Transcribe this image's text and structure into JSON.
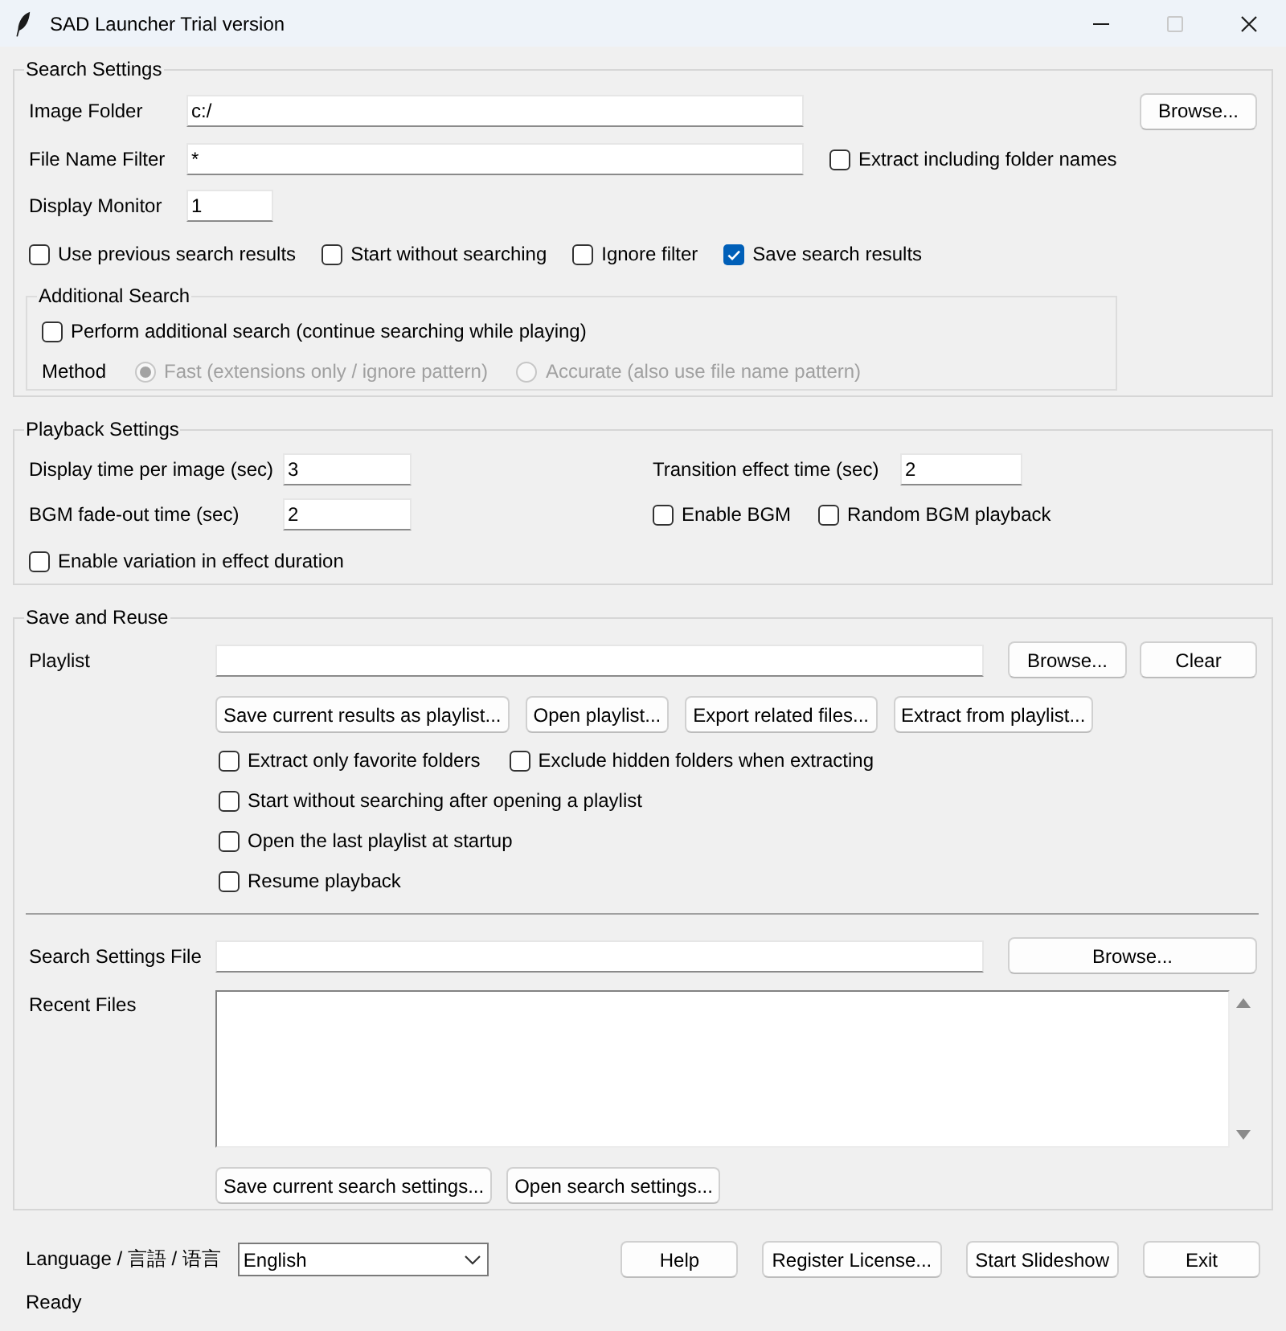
{
  "window": {
    "title": "SAD Launcher Trial version",
    "maximize_disabled": true
  },
  "search_settings": {
    "title": "Search Settings",
    "image_folder": {
      "label": "Image Folder",
      "value": "c:/",
      "button": "Browse..."
    },
    "file_name_filter": {
      "label": "File Name Filter",
      "value": "*",
      "option": {
        "label": "Extract including folder names",
        "checked": false
      }
    },
    "display_monitor": {
      "label": "Display Monitor",
      "value": "1"
    },
    "options": [
      {
        "label": "Use previous search results",
        "checked": false
      },
      {
        "label": "Start without searching",
        "checked": false
      },
      {
        "label": "Ignore filter",
        "checked": false
      },
      {
        "label": "Save search results",
        "checked": true
      }
    ],
    "additional_search": {
      "title": "Additional Search",
      "perform": {
        "label": "Perform additional search (continue searching while playing)",
        "checked": false
      },
      "method_label": "Method",
      "methods": [
        {
          "label": "Fast (extensions only / ignore pattern)",
          "selected": true,
          "disabled": true
        },
        {
          "label": "Accurate (also use file name pattern)",
          "selected": false,
          "disabled": true
        }
      ]
    }
  },
  "playback_settings": {
    "title": "Playback Settings",
    "display_time": {
      "label": "Display time per image (sec)",
      "value": "3"
    },
    "transition_time": {
      "label": "Transition effect time (sec)",
      "value": "2"
    },
    "fade_out_time": {
      "label": "BGM fade-out time (sec)",
      "value": "2"
    },
    "bgm_options": [
      {
        "label": "Enable BGM",
        "checked": false
      },
      {
        "label": "Random BGM playback",
        "checked": false
      }
    ],
    "variation": {
      "label": "Enable variation in effect duration",
      "checked": false
    }
  },
  "save_and_reuse": {
    "title": "Save and Reuse",
    "playlist": {
      "label": "Playlist",
      "buttons": [
        "Browse...",
        "Clear"
      ]
    },
    "playlist_actions": [
      "Save current results as playlist...",
      "Open playlist...",
      "Export related files...",
      "Extract from playlist..."
    ],
    "option_rows": [
      [
        {
          "label": "Extract only favorite folders",
          "checked": false
        },
        {
          "label": "Exclude hidden folders when extracting",
          "checked": false
        }
      ],
      [
        {
          "label": "Start without searching after opening a playlist",
          "checked": false
        }
      ],
      [
        {
          "label": "Open the last playlist at startup",
          "checked": false
        }
      ],
      [
        {
          "label": "Resume playback",
          "checked": false
        }
      ]
    ],
    "settings_file": {
      "label": "Search Settings File",
      "button": "Browse..."
    },
    "recent_files": {
      "label": "Recent Files"
    },
    "settings_actions": [
      "Save current search settings...",
      "Open search settings..."
    ]
  },
  "footer": {
    "language_label": "Language / 言語 / 语言",
    "language": "English",
    "buttons": [
      "Help",
      "Register License...",
      "Start Slideshow",
      "Exit"
    ]
  },
  "status_bar": {
    "text": "Ready"
  }
}
